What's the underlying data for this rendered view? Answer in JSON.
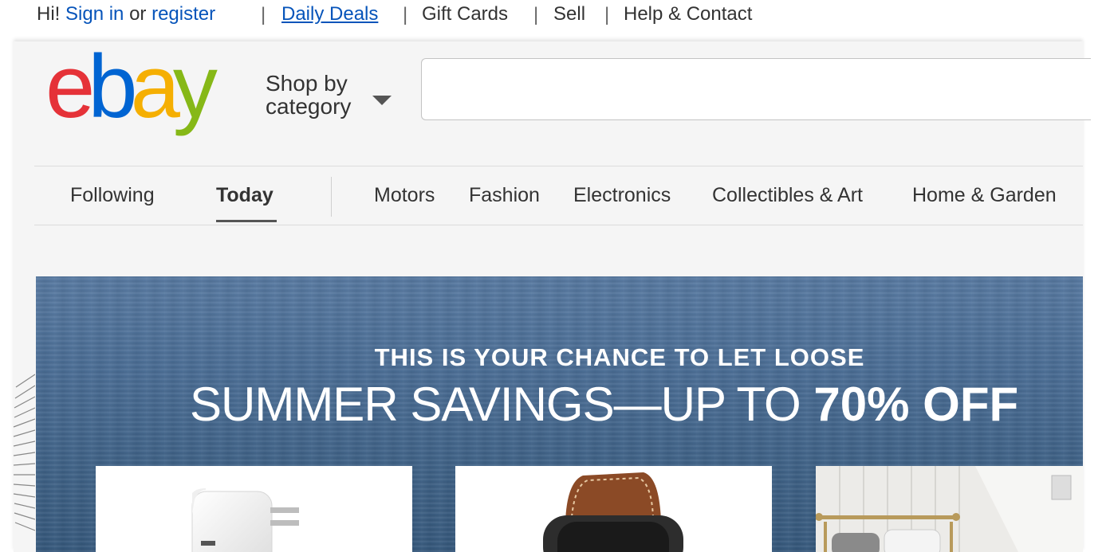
{
  "topbar": {
    "greeting_prefix": "Hi!",
    "sign_in": "Sign in",
    "or": "or",
    "register": "register",
    "links": [
      "Daily Deals",
      "Gift Cards",
      "Sell",
      "Help & Contact"
    ]
  },
  "header": {
    "logo": {
      "e": "e",
      "b": "b",
      "a": "a",
      "y": "y"
    },
    "shop_by_category": {
      "line1": "Shop by",
      "line2": "category"
    },
    "search": {
      "value": "",
      "placeholder": ""
    }
  },
  "nav": {
    "following": "Following",
    "today": "Today",
    "categories": [
      "Motors",
      "Fashion",
      "Electronics",
      "Collectibles & Art",
      "Home & Garden"
    ]
  },
  "banner": {
    "kicker": "THIS IS YOUR CHANCE TO LET LOOSE",
    "headline_light": "SUMMER SAVINGS—UP TO",
    "headline_bold": "70% OFF"
  },
  "colors": {
    "link": "#0654ba",
    "logo_e": "#e53238",
    "logo_b": "#0064d2",
    "logo_a": "#f5af02",
    "logo_y": "#86b817"
  }
}
